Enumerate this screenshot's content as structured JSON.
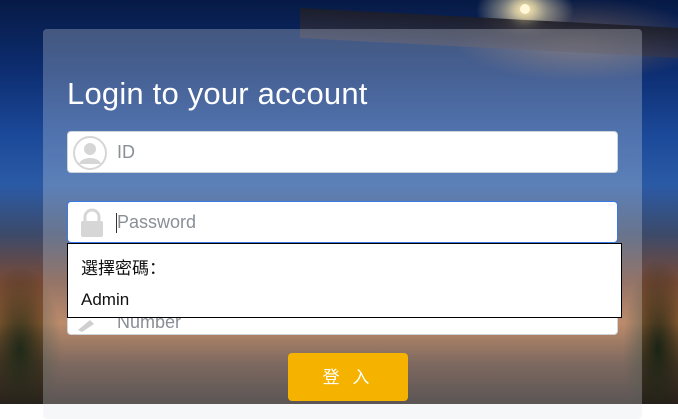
{
  "login": {
    "title": "Login to your account",
    "id_placeholder": "ID",
    "password_placeholder": "Password",
    "number_placeholder": "Number",
    "submit_label": "登 入"
  },
  "password_suggestions": {
    "header": "選擇密碼：",
    "options": [
      "Admin"
    ]
  },
  "icons": {
    "id_field": "user-avatar-icon",
    "password_field": "lock-icon",
    "number_field": "pencil-icon"
  },
  "colors": {
    "submit_button": "#f5b300",
    "focus_border": "#3b78e7"
  }
}
